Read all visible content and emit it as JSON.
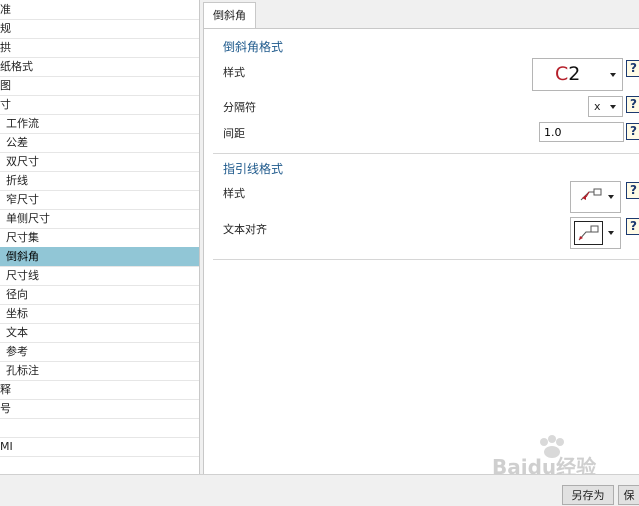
{
  "tree": {
    "items": [
      {
        "label": "准"
      },
      {
        "label": "规"
      },
      {
        "label": "拱"
      },
      {
        "label": "纸格式"
      },
      {
        "label": "图"
      },
      {
        "label": "寸"
      },
      {
        "label": "工作流"
      },
      {
        "label": "公差"
      },
      {
        "label": "双尺寸"
      },
      {
        "label": "折线"
      },
      {
        "label": "窄尺寸"
      },
      {
        "label": "单侧尺寸"
      },
      {
        "label": "尺寸集"
      },
      {
        "label": "倒斜角"
      },
      {
        "label": "尺寸线"
      },
      {
        "label": "径向"
      },
      {
        "label": "坐标"
      },
      {
        "label": "文本"
      },
      {
        "label": "参考"
      },
      {
        "label": "孔标注"
      },
      {
        "label": "释"
      },
      {
        "label": "号"
      },
      {
        "label": ""
      },
      {
        "label": "MI"
      }
    ],
    "selected_index": 13
  },
  "tab": {
    "label": "倒斜角"
  },
  "chamfer_format": {
    "title": "倒斜角格式",
    "style_label": "样式",
    "style_value_letter": "C",
    "style_value_number": "2",
    "separator_label": "分隔符",
    "separator_value": "x",
    "spacing_label": "间距",
    "spacing_value": "1.0"
  },
  "leader_format": {
    "title": "指引线格式",
    "style_label": "样式",
    "text_align_label": "文本对齐"
  },
  "help": {
    "glyph": "?"
  },
  "buttons": {
    "save_as": "另存为",
    "partial": "保"
  },
  "watermark": {
    "text": "Baidu经验"
  },
  "colors": {
    "selection": "#91c6d6",
    "section_title": "#1f5a8c",
    "c2_letter": "#b51f2a"
  }
}
